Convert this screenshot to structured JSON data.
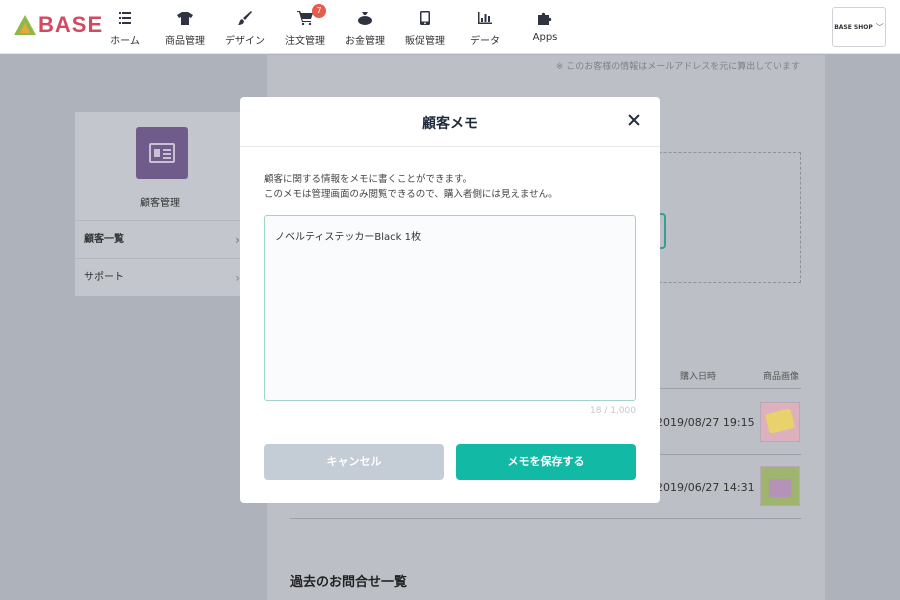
{
  "app": {
    "logo": "BASE",
    "shop_button": "BASE SHOP"
  },
  "nav": [
    {
      "label": "ホーム",
      "icon": "list-icon"
    },
    {
      "label": "商品管理",
      "icon": "tshirt-icon"
    },
    {
      "label": "デザイン",
      "icon": "brush-icon"
    },
    {
      "label": "注文管理",
      "icon": "cart-icon",
      "badge": "7"
    },
    {
      "label": "お金管理",
      "icon": "wallet-icon"
    },
    {
      "label": "販促管理",
      "icon": "phone-icon"
    },
    {
      "label": "データ",
      "icon": "bar-chart-icon"
    },
    {
      "label": "Apps",
      "icon": "puzzle-icon"
    }
  ],
  "page": {
    "note": "※ このお客様の情報はメールアドレスを元に算出しています",
    "table_headers": {
      "date": "購入日時",
      "image": "商品画像"
    },
    "rows": [
      {
        "date": "2019/08/27 19:15"
      },
      {
        "date": "2019/06/27 14:31"
      }
    ],
    "section_title": "過去のお問合せ一覧"
  },
  "sidebar": {
    "title": "顧客管理",
    "items": [
      {
        "label": "顧客一覧"
      },
      {
        "label": "サポート"
      }
    ]
  },
  "modal": {
    "title": "顧客メモ",
    "description_line1": "顧客に関する情報をメモに書くことができます。",
    "description_line2": "このメモは管理画面のみ閲覧できるので、購入者側には見えません。",
    "memo_value": "ノベルティステッカーBlack 1枚",
    "counter": "18 / 1,000",
    "cancel_label": "キャンセル",
    "save_label": "メモを保存する"
  },
  "colors": {
    "accent": "#12b9a5",
    "cancel": "#c4ccd6",
    "badge": "#e55b4d",
    "sidebar_icon": "#6f5c8b"
  }
}
